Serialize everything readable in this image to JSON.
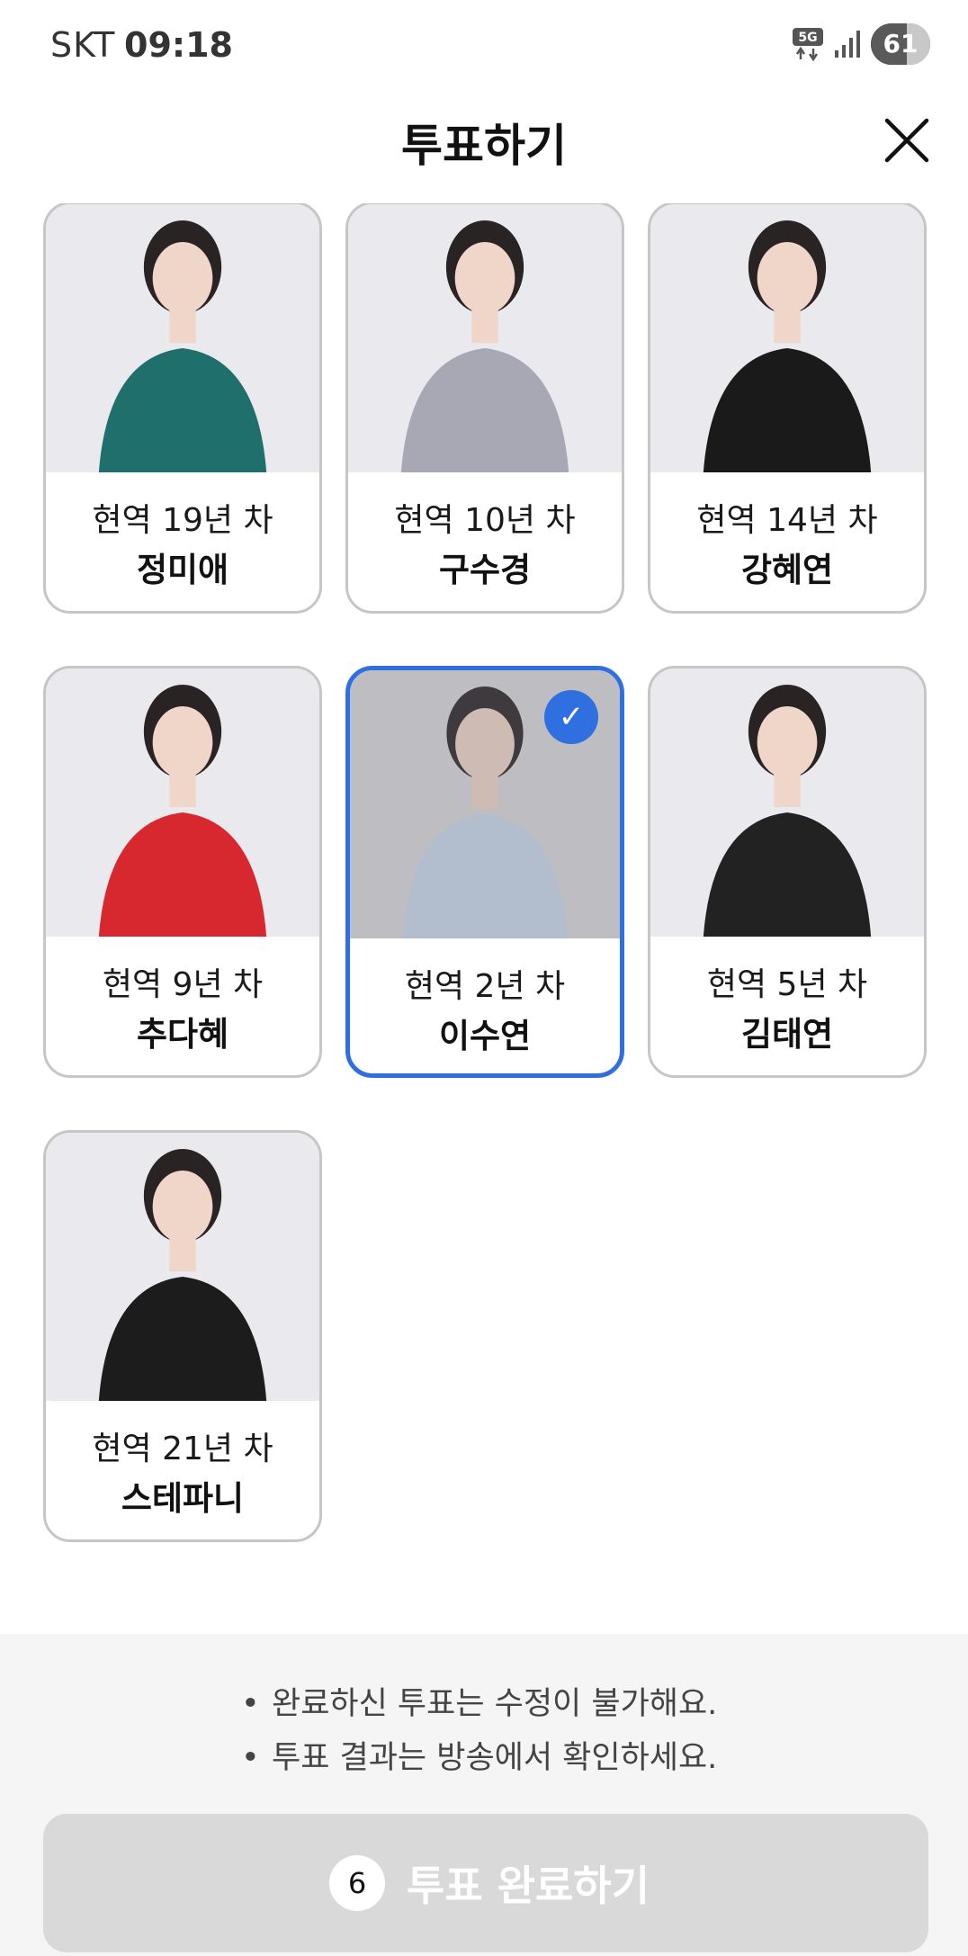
{
  "status_bar": {
    "carrier": "SKT",
    "time": "09:18",
    "network": "5G",
    "battery": "61",
    "battery_level": 0.61
  },
  "header": {
    "title": "투표하기",
    "close_icon": "close-icon"
  },
  "candidates": [
    {
      "career": "현역 19년 차",
      "name": "정미애",
      "selected": false,
      "outfit_color": "#1f6f6c"
    },
    {
      "career": "현역 10년 차",
      "name": "구수경",
      "selected": false,
      "outfit_color": "#a8a8b4"
    },
    {
      "career": "현역 14년 차",
      "name": "강혜연",
      "selected": false,
      "outfit_color": "#1a1a1a"
    },
    {
      "career": "현역 9년 차",
      "name": "추다혜",
      "selected": false,
      "outfit_color": "#d8282f"
    },
    {
      "career": "현역 2년 차",
      "name": "이수연",
      "selected": true,
      "outfit_color": "#c9d8ea"
    },
    {
      "career": "현역 5년 차",
      "name": "김태연",
      "selected": false,
      "outfit_color": "#222222"
    },
    {
      "career": "현역 21년 차",
      "name": "스테파니",
      "selected": false,
      "outfit_color": "#1c1c1c"
    }
  ],
  "notices": [
    "완료하신 투표는 수정이 불가해요.",
    "투표 결과는 방송에서 확인하세요."
  ],
  "submit": {
    "count": "6",
    "label": "투표 완료하기"
  },
  "colors": {
    "accent": "#2f6fe0",
    "button_disabled": "#d9d9d9",
    "card_border": "#c6c6c6"
  }
}
